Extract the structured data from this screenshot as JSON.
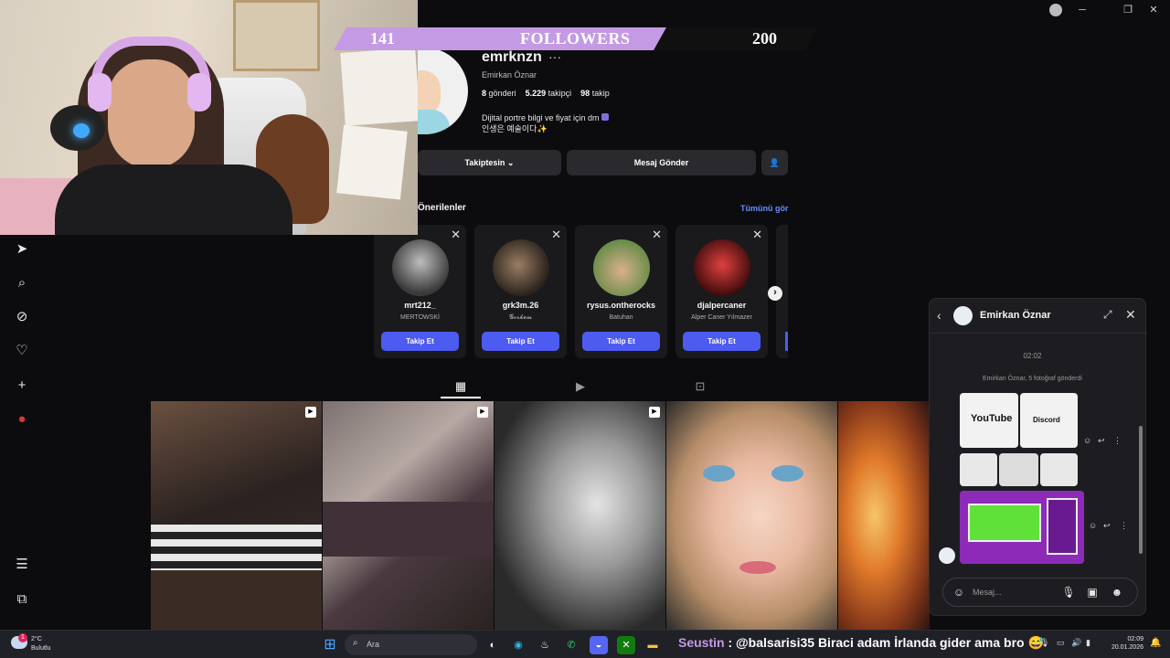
{
  "followers_overlay": {
    "current": "141",
    "label": "FOLLOWERS",
    "goal": "200",
    "progress": 0.705
  },
  "profile": {
    "username": "emrknzn",
    "more": "···",
    "full_name": "Emirkan Öznar",
    "posts_count": "8",
    "posts_label": "gönderi",
    "followers_count": "5.229",
    "followers_label": "takipçi",
    "following_count": "98",
    "following_label": "takip",
    "bio_line1": "Dijital portre bilgi ve fiyat için dm",
    "bio_line2": "인생은 예술이다✨",
    "following_button": "Takiptesin",
    "message_button": "Mesaj Gönder"
  },
  "suggestions": {
    "title": "Önerilenler",
    "see_all": "Tümünü gör",
    "follow_label": "Takip Et",
    "items": [
      {
        "name": "mrt212_",
        "sub": "MERTOWSKİ"
      },
      {
        "name": "grk3m.26",
        "sub": "𝓖𝓸𝓻𝓴𝓮𝓶"
      },
      {
        "name": "rysus.ontherocks",
        "sub": "Batuhan"
      },
      {
        "name": "djalpercaner",
        "sub": "Alper Caner Yılmazer"
      }
    ]
  },
  "chat": {
    "contact_name": "Emirkan Öznar",
    "time": "02:02",
    "note": "Emirkan Öznar, 5 fotoğraf gönderdi",
    "thumb_youtube": "YouTube",
    "thumb_discord": "Discord",
    "input_placeholder": "Mesaj..."
  },
  "taskbar": {
    "temperature": "2°C",
    "weather": "Bulutlu",
    "search_placeholder": "Ara",
    "ticker_user": "Seustin",
    "ticker_text": ": @balsarisi35 Biraci adam İrlanda gider ama bro 😅",
    "time": "02:09",
    "date": "20.01.2026",
    "notification_count": "1"
  },
  "colors": {
    "accent": "#4e5bf0",
    "overlay": "#c39ae3",
    "link": "#6b8cff"
  }
}
